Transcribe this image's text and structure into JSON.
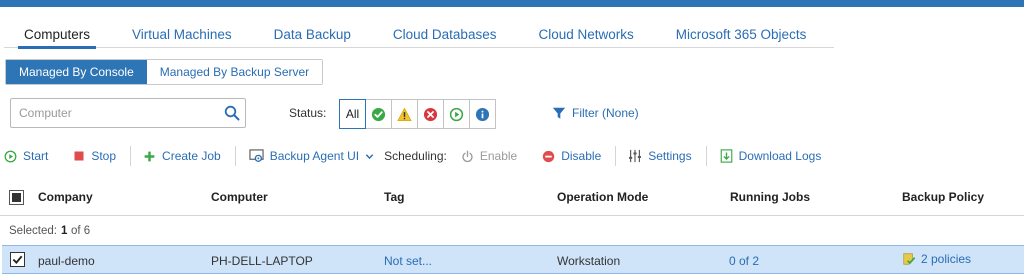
{
  "colors": {
    "accent": "#2e75b5",
    "link": "#2a6db5",
    "selected_row": "#cfe3f9"
  },
  "main_tabs": [
    {
      "label": "Computers",
      "active": true
    },
    {
      "label": "Virtual Machines",
      "active": false
    },
    {
      "label": "Data Backup",
      "active": false
    },
    {
      "label": "Cloud Databases",
      "active": false
    },
    {
      "label": "Cloud Networks",
      "active": false
    },
    {
      "label": "Microsoft 365 Objects",
      "active": false
    }
  ],
  "sub_tabs": [
    {
      "label": "Managed By Console",
      "active": true
    },
    {
      "label": "Managed By Backup Server",
      "active": false
    }
  ],
  "search": {
    "placeholder": "Computer",
    "value": ""
  },
  "status": {
    "label": "Status:",
    "all_label": "All",
    "filters": [
      "success-icon",
      "warning-icon",
      "error-icon",
      "running-icon",
      "info-icon"
    ]
  },
  "filter": {
    "label": "Filter (None)"
  },
  "toolbar": {
    "start": "Start",
    "stop": "Stop",
    "create_job": "Create Job",
    "backup_agent_ui": "Backup Agent UI",
    "scheduling": "Scheduling:",
    "enable": "Enable",
    "disable": "Disable",
    "settings": "Settings",
    "download_logs": "Download Logs"
  },
  "table": {
    "columns": {
      "company": "Company",
      "computer": "Computer",
      "tag": "Tag",
      "operation_mode": "Operation Mode",
      "running_jobs": "Running Jobs",
      "backup_policy": "Backup Policy"
    },
    "selection": {
      "prefix": "Selected:",
      "count": "1",
      "suffix": "of 6"
    },
    "rows": [
      {
        "company": "paul-demo",
        "computer": "PH-DELL-LAPTOP",
        "tag": "Not set...",
        "operation_mode": "Workstation",
        "running_jobs": "0 of 2",
        "backup_policy": "2 policies"
      }
    ]
  }
}
